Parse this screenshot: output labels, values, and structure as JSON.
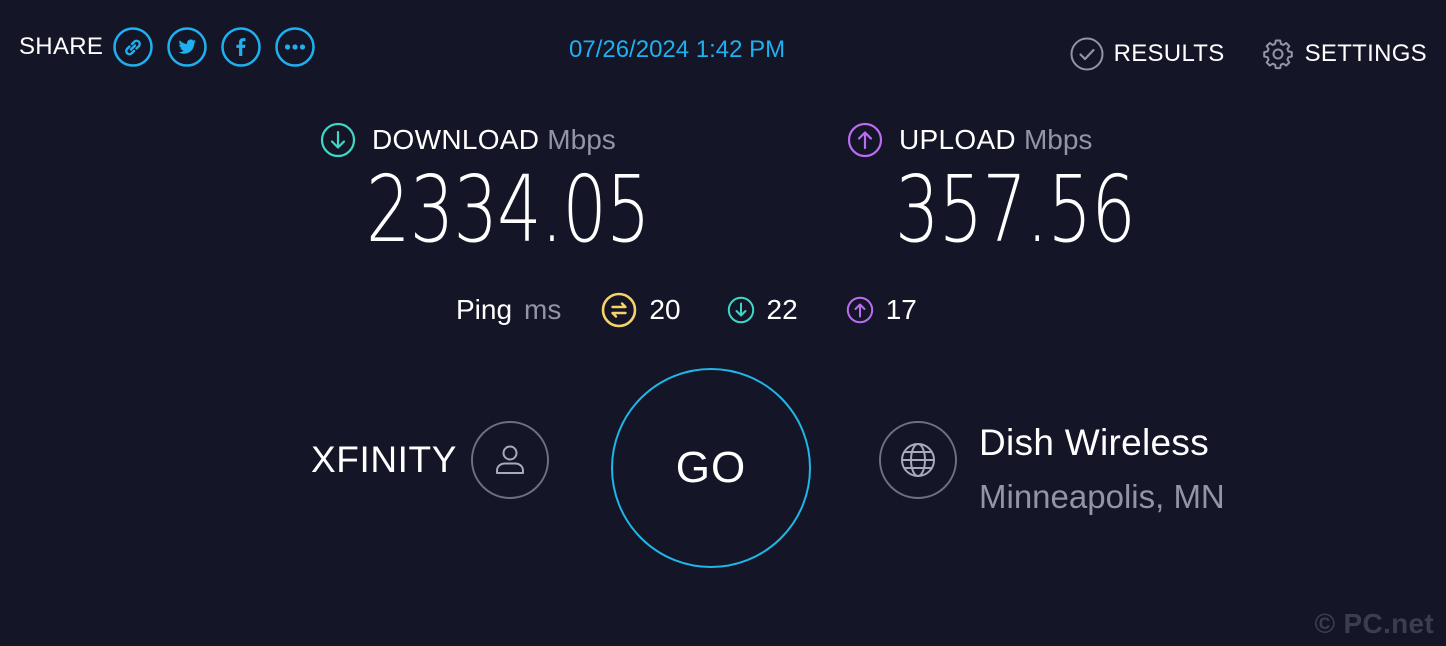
{
  "share": {
    "label": "SHARE",
    "buttons": [
      {
        "icon": "link-icon",
        "label": "link"
      },
      {
        "icon": "twitter-icon",
        "label": "twitter"
      },
      {
        "icon": "facebook-icon",
        "label": "facebook"
      },
      {
        "icon": "more-icon",
        "label": "more"
      }
    ]
  },
  "header": {
    "datetime": "07/26/2024 1:42 PM",
    "results_label": "RESULTS",
    "settings_label": "SETTINGS"
  },
  "download": {
    "title": "DOWNLOAD",
    "unit": "Mbps",
    "value": "2334.05",
    "icon": "download-arrow-icon",
    "color": "#3fd7c6"
  },
  "upload": {
    "title": "UPLOAD",
    "unit": "Mbps",
    "value": "357.56",
    "icon": "upload-arrow-icon",
    "color": "#bb6cf2"
  },
  "ping": {
    "label": "Ping",
    "unit": "ms",
    "idle": "20",
    "download": "22",
    "upload": "17",
    "idle_color": "#f5d36a"
  },
  "provider": {
    "name": "XFINITY",
    "icon": "user-icon"
  },
  "go": {
    "label": "GO",
    "color": "#1fb6e8"
  },
  "server": {
    "name": "Dish Wireless",
    "location": "Minneapolis, MN",
    "icon": "globe-icon"
  },
  "watermark": "© PC.net",
  "colors": {
    "background": "#141526",
    "accent": "#1fb0f0",
    "muted": "#9195a8"
  }
}
